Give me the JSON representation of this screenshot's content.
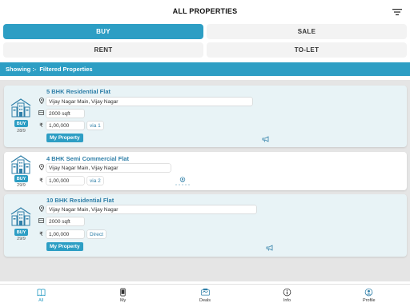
{
  "header": {
    "title": "ALL PROPERTIES"
  },
  "segments": {
    "buy": "BUY",
    "sale": "SALE",
    "rent": "RENT",
    "tolet": "TO-LET",
    "selected": "BUY"
  },
  "showing": {
    "prefix": "Showing :-",
    "label": "Filtered Properties"
  },
  "listings": [
    {
      "title": "5 BHK Residential Flat",
      "address": "Vijay Nagar Main, Vijay Nagar",
      "area": "2000 sqft",
      "price": "1,00,000",
      "via": "via 1",
      "badge": "BUY",
      "date": "28/9",
      "my_property": "My Property"
    },
    {
      "title": "4 BHK Semi Commercial Flat",
      "address": "Vijay Nagar Main, Vijay Nagar",
      "price": "1,00,000",
      "via": "via 2",
      "badge": "BUY",
      "date": "29/9"
    },
    {
      "title": "10 BHK Residential Flat",
      "address": "Vijay Nagar Main, Vijay Nagar",
      "area": "2000 sqft",
      "price": "1,00,000",
      "via": "Direct",
      "badge": "BUY",
      "date": "29/9",
      "my_property": "My Property"
    }
  ],
  "currency_symbol": "₹",
  "bottom_nav": [
    {
      "label": "All",
      "icon": "book-icon",
      "active": true
    },
    {
      "label": "My",
      "icon": "phone-icon",
      "active": false
    },
    {
      "label": "Deals",
      "icon": "handshake-icon",
      "active": false
    },
    {
      "label": "Info",
      "icon": "info-icon",
      "active": false
    },
    {
      "label": "Profile",
      "icon": "profile-icon",
      "active": false
    }
  ],
  "colors": {
    "accent": "#2d9ec4",
    "title_text": "#2f7fa8",
    "list_bg": "#e5e5e5",
    "card_tint": "#e8f3f6"
  }
}
